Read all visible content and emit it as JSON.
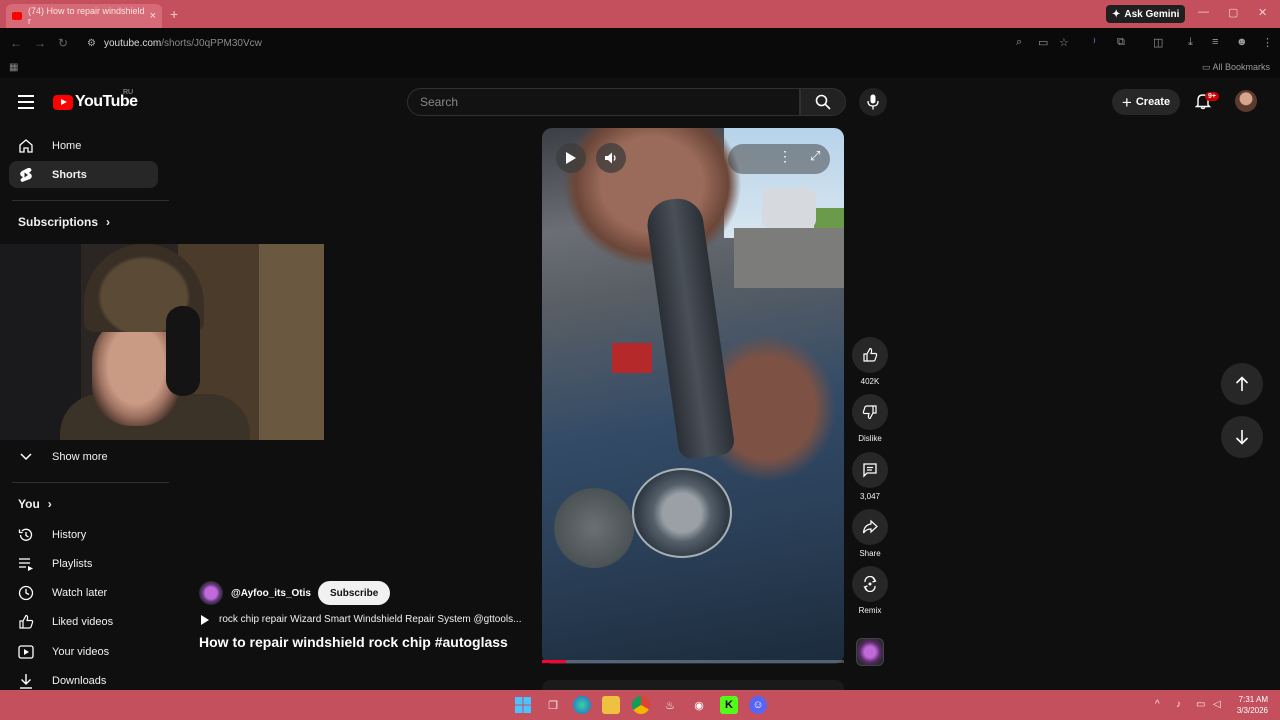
{
  "browser": {
    "tab_title": "(74) How to repair windshield r",
    "url_host": "youtube.com",
    "url_path": "/shorts/J0qPPM30Vcw",
    "ask_gemini": "Ask Gemini",
    "all_bookmarks": "All Bookmarks"
  },
  "masthead": {
    "logo_text": "YouTube",
    "region": "RU",
    "search_placeholder": "Search",
    "create_label": "Create",
    "notif_badge": "9+"
  },
  "sidebar": {
    "items": [
      {
        "label": "Home",
        "icon": "home-icon"
      },
      {
        "label": "Shorts",
        "icon": "shorts-icon"
      }
    ],
    "subscriptions_label": "Subscriptions",
    "show_more_label": "Show more",
    "you_label": "You",
    "you_items": [
      {
        "label": "History",
        "icon": "history-icon"
      },
      {
        "label": "Playlists",
        "icon": "playlists-icon"
      },
      {
        "label": "Watch later",
        "icon": "watch-later-icon"
      },
      {
        "label": "Liked videos",
        "icon": "liked-icon"
      },
      {
        "label": "Your videos",
        "icon": "your-videos-icon"
      },
      {
        "label": "Downloads",
        "icon": "downloads-icon"
      }
    ]
  },
  "short": {
    "channel": "@Ayfoo_its_Otis",
    "subscribe_label": "Subscribe",
    "sound": "rock chip repair Wizard Smart Windshield Repair System @gttools...",
    "title": "How to repair windshield rock chip #autoglass",
    "progress": 0.08
  },
  "actions": {
    "like_count": "402K",
    "dislike_label": "Dislike",
    "comment_count": "3,047",
    "share_label": "Share",
    "remix_label": "Remix"
  },
  "taskbar": {
    "time": "7:31 AM",
    "date": "3/3/2026"
  },
  "colors": {
    "accent_red": "#ff0000",
    "chrome_frame": "#c4505e",
    "background": "#0f0f0f"
  }
}
